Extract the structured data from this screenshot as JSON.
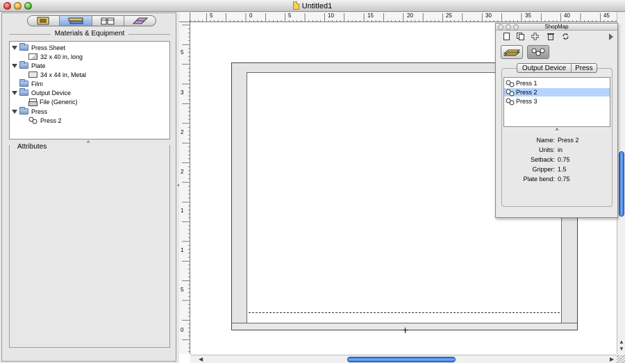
{
  "window": {
    "title": "Untitled1"
  },
  "left_panel": {
    "tabs": [
      {
        "icon": "press-sheet-tab-icon",
        "active": false
      },
      {
        "icon": "equipment-tab-icon",
        "active": true
      },
      {
        "icon": "products-tab-icon",
        "active": false
      },
      {
        "icon": "layout-tab-icon",
        "active": false
      }
    ],
    "materials_title": "Materials & Equipment",
    "tree": [
      {
        "label": "Press Sheet",
        "children": [
          "32 x 40 in, long"
        ]
      },
      {
        "label": "Plate",
        "children": [
          "34 x 44 in, Metal"
        ]
      },
      {
        "label": "Film",
        "children": []
      },
      {
        "label": "Output Device",
        "children": [
          "File (Generic)"
        ]
      },
      {
        "label": "Press",
        "children": [
          "Press 2"
        ]
      }
    ],
    "splitter_glyph": "^",
    "attributes_title": "Attributes"
  },
  "ruler": {
    "h_labels": [
      "5",
      "0",
      "5",
      "10",
      "15",
      "20",
      "25",
      "30",
      "35",
      "40",
      "45"
    ],
    "v_labels": [
      "5",
      "3",
      "2",
      "2",
      "1",
      "1",
      "5",
      "0"
    ]
  },
  "shopmap": {
    "title": "ShopMap",
    "toolbar_icons": [
      "new-doc-icon",
      "duplicate-icon",
      "add-icon",
      "trash-icon",
      "refresh-icon"
    ],
    "segments": {
      "left": "Output Device",
      "right": "Press"
    },
    "list": [
      "Press 1",
      "Press 2",
      "Press 3"
    ],
    "selected_index": 1,
    "splitter_glyph": "^",
    "props": [
      {
        "label": "Name:",
        "value": "Press 2"
      },
      {
        "label": "Units:",
        "value": "in"
      },
      {
        "label": "Setback:",
        "value": "0.75"
      },
      {
        "label": "Gripper:",
        "value": "1.5"
      },
      {
        "label": "Plate bend:",
        "value": "0.75"
      }
    ]
  },
  "colors": {
    "selection": "#b5d3ff",
    "scroll_thumb": "#4a8ae6"
  }
}
